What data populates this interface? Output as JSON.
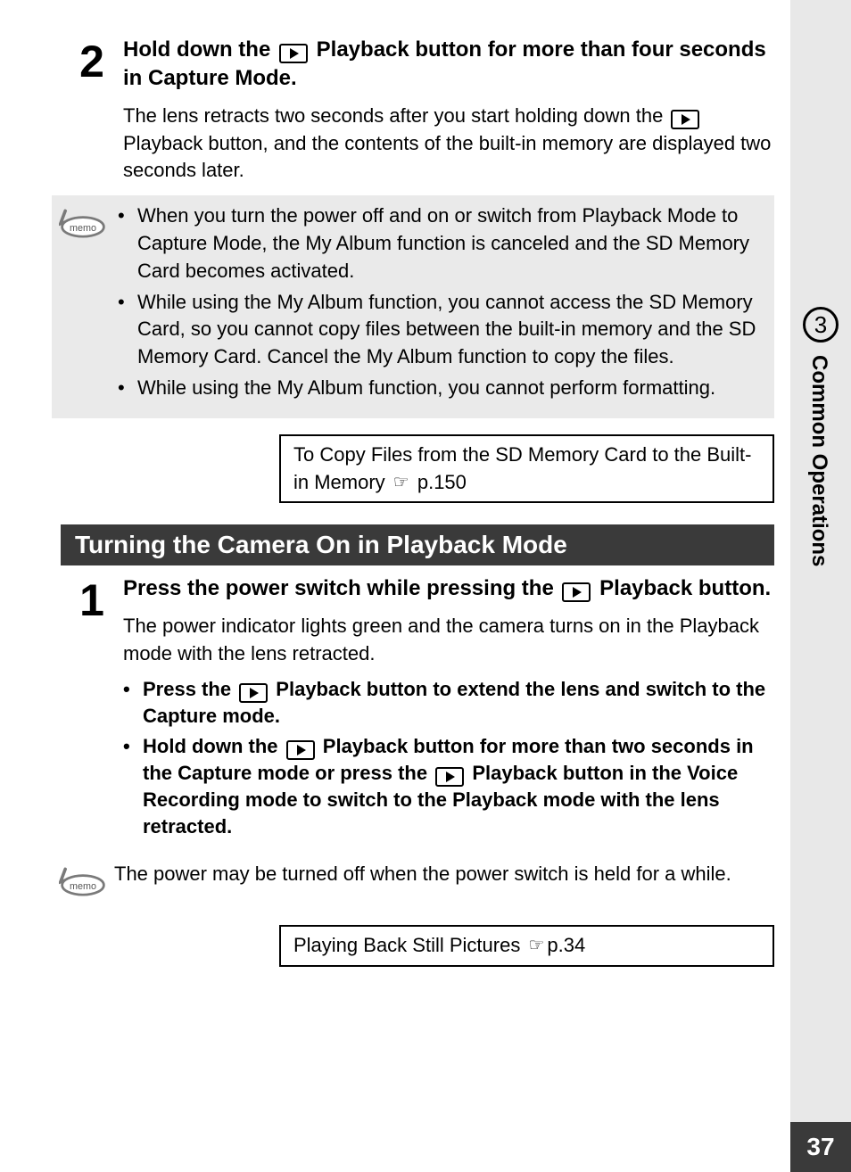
{
  "page_number": "37",
  "chapter_number": "3",
  "chapter_title": "Common Operations",
  "step2": {
    "num": "2",
    "head_a": "Hold down the ",
    "head_b": " Playback button for more than four seconds in Capture Mode.",
    "para_a": "The lens retracts two seconds after you start holding down the ",
    "para_b": " Playback button, and the contents of the built-in memory are displayed two seconds later."
  },
  "memo1": {
    "items": [
      "When you turn the power off and on or switch from Playback Mode to Capture Mode, the My Album function is canceled and the SD Memory Card becomes activated.",
      "While using the My Album function, you cannot access the SD Memory Card, so you cannot copy files between the built-in memory and the SD Memory Card. Cancel the My Album function to copy the files.",
      "While using the My Album function, you cannot perform formatting."
    ]
  },
  "xref1_a": "To Copy Files from the SD Memory Card to the Built-in Memory ",
  "xref1_b": " p.150",
  "section_title": "Turning the Camera On in Playback Mode",
  "step1": {
    "num": "1",
    "head_a": "Press the power switch while pressing the ",
    "head_b": " Playback button.",
    "para": "The power indicator lights green and the camera turns on in the Playback mode with the lens retracted.",
    "b1_a": "Press the ",
    "b1_b": " Playback button to extend the lens and switch to the Capture mode.",
    "b2_a": "Hold down the ",
    "b2_b": " Playback button for more than two seconds in the Capture mode or press the ",
    "b2_c": " Playback button in the Voice Recording mode to switch to the Playback mode with the lens retracted."
  },
  "memo2": "The power may be turned off when the power switch is held for a while.",
  "xref2_a": "Playing Back Still Pictures ",
  "xref2_b": "p.34"
}
